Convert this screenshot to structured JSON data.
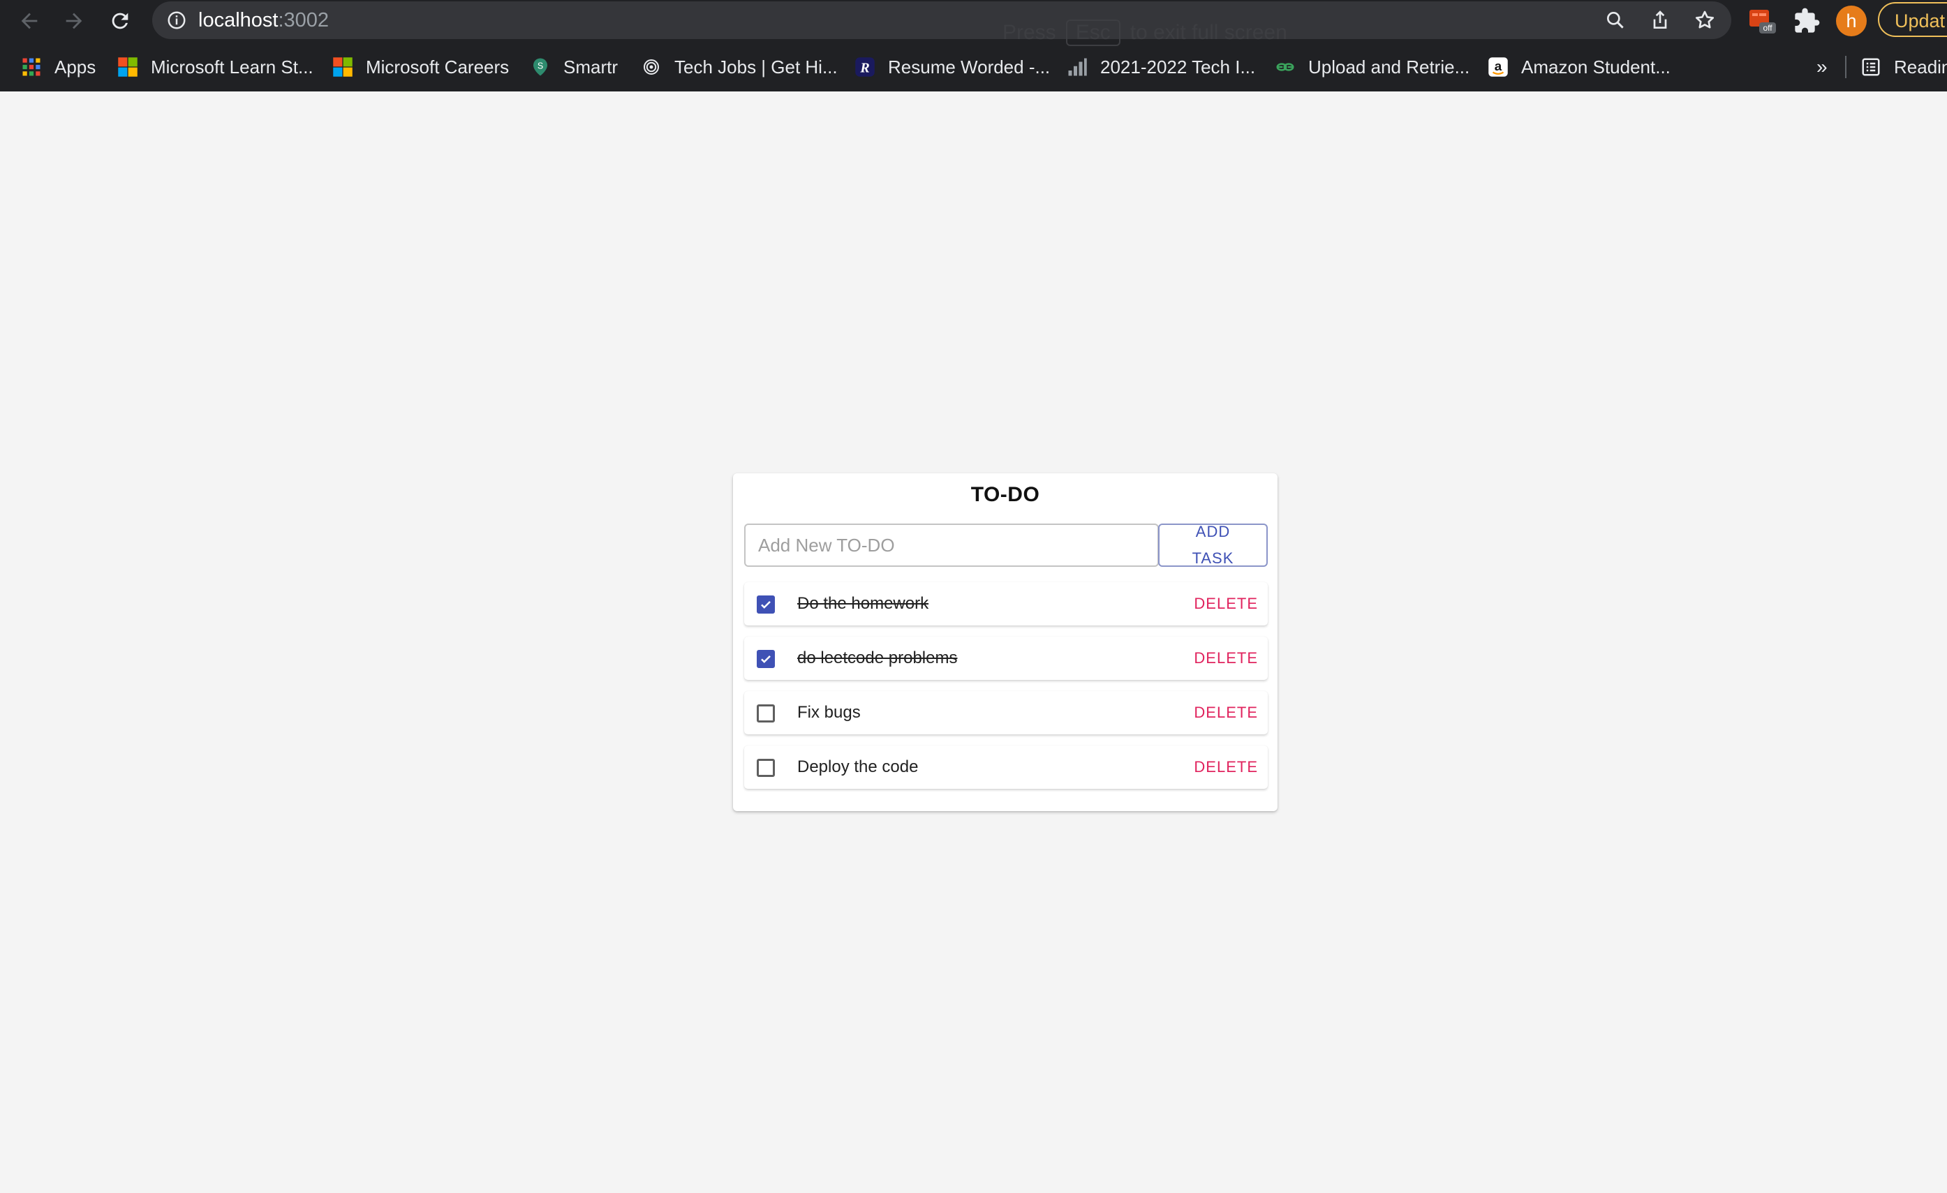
{
  "browser": {
    "url_host": "localhost",
    "url_port": ":3002",
    "fullscreen_hint": {
      "prefix": "Press",
      "key": "Esc",
      "suffix": "to exit full screen"
    },
    "extension_badge": "off",
    "avatar_letter": "h",
    "update_label": "Updat",
    "bookmarks": [
      {
        "label": "Apps",
        "icon": "apps-grid-icon"
      },
      {
        "label": "Microsoft Learn St...",
        "icon": "microsoft-logo-icon"
      },
      {
        "label": "Microsoft Careers",
        "icon": "microsoft-logo-icon"
      },
      {
        "label": "Smartr",
        "icon": "smartr-icon"
      },
      {
        "label": "Tech Jobs | Get Hi...",
        "icon": "fingerprint-icon"
      },
      {
        "label": "Resume Worded -...",
        "icon": "resume-worded-icon"
      },
      {
        "label": "2021-2022 Tech I...",
        "icon": "chart-icon"
      },
      {
        "label": "Upload and Retrie...",
        "icon": "link-icon"
      },
      {
        "label": "Amazon Student...",
        "icon": "amazon-icon"
      }
    ],
    "bookmarks_more": "»",
    "reading_list_label": "Readin"
  },
  "todo": {
    "title": "TO-DO",
    "input_placeholder": "Add New TO-DO",
    "input_value": "",
    "add_button_label": "ADD TASK",
    "delete_label": "DELETE",
    "tasks": [
      {
        "text": "Do the homework",
        "done": true
      },
      {
        "text": "do leetcode problems",
        "done": true
      },
      {
        "text": "Fix bugs",
        "done": false
      },
      {
        "text": "Deploy the code",
        "done": false
      }
    ]
  },
  "colors": {
    "page_bg": "#f4f4f4",
    "primary": "#3f51b5",
    "delete": "#e0245e",
    "chrome_bg": "#202124"
  }
}
